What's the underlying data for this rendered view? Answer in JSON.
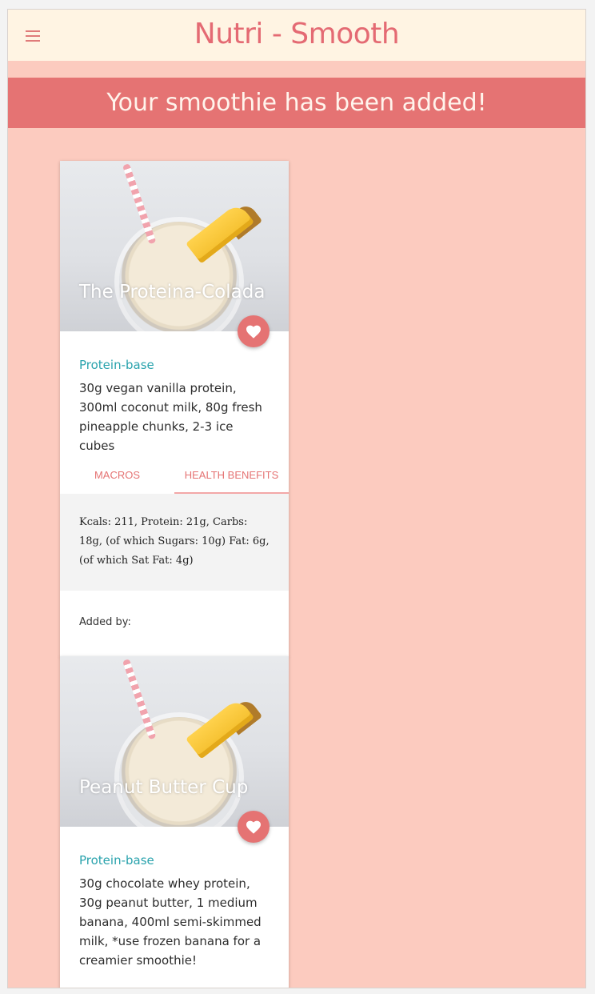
{
  "app": {
    "title": "Nutri - Smooth"
  },
  "banner": {
    "message": "Your smoothie has been added!"
  },
  "cards": [
    {
      "title": "The Proteina-Colada",
      "base": "Protein-base",
      "ingredients": "30g vegan vanilla protein, 300ml coconut milk, 80g fresh pineapple chunks, 2-3 ice cubes",
      "tabs": {
        "macros": "MACROS",
        "health": "HEALTH BENEFITS"
      },
      "macros": "Kcals: 211, Protein: 21g, Carbs: 18g, (of which Sugars: 10g) Fat: 6g, (of which Sat Fat: 4g)",
      "added_by": "Added by:"
    },
    {
      "title": "Peanut Butter Cup",
      "base": "Protein-base",
      "ingredients": "30g chocolate whey protein, 30g peanut butter, 1 medium banana, 400ml semi-skimmed milk, *use frozen banana for a creamier smoothie!"
    }
  ],
  "icons": {
    "menu": "menu-icon",
    "favorite": "heart-icon"
  },
  "colors": {
    "accent": "#e57373",
    "background": "#fccbbf",
    "navbar": "#fff4e3",
    "teal": "#2aa3ad"
  }
}
